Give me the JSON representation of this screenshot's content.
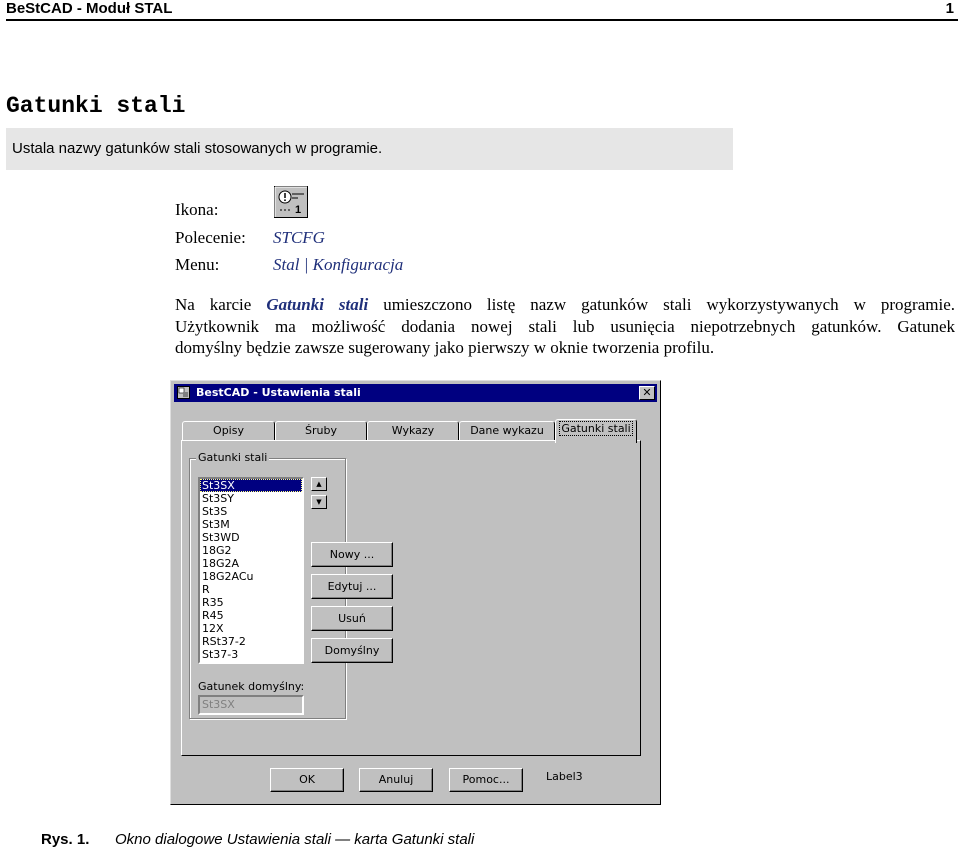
{
  "header": {
    "title": "BeStCAD - Moduł STAL",
    "page_number": "1"
  },
  "section": {
    "title": "Gatunki stali",
    "summary": "Ustala nazwy gatunków stali stosowanych w programie."
  },
  "meta": {
    "icon_label": "Ikona:",
    "command_label": "Polecenie:",
    "command_value": "STCFG",
    "menu_label": "Menu:",
    "menu_value": "Stal | Konfiguracja",
    "icon_name": "steel-config-toolbar-icon"
  },
  "paragraph": {
    "line1_before": "Na karcie ",
    "line1_emph": "Gatunki stali",
    "line1_after": " umieszczono listę nazw gatunków stali wykorzystywanych w programie.",
    "line2": "Użytkownik ma możliwość dodania nowej stali lub usunięcia niepotrzebnych gatunków. Gatunek",
    "line3": "domyślny będzie zawsze sugerowany jako pierwszy w oknie tworzenia profilu."
  },
  "dialog": {
    "title": "BestCAD - Ustawienia stali",
    "close_glyph": "✕",
    "tabs": [
      "Opisy",
      "Śruby",
      "Wykazy",
      "Dane wykazu",
      "Gatunki stali"
    ],
    "active_tab": "Gatunki stali",
    "group_label": "Gatunki stali",
    "steel_grades": [
      "St3SX",
      "St3SY",
      "St3S",
      "St3M",
      "St3WD",
      "18G2",
      "18G2A",
      "18G2ACu",
      "R",
      "R35",
      "R45",
      "12X",
      "RSt37-2",
      "St37-3"
    ],
    "selected_grade": "St3SX",
    "spin_up": "▲",
    "spin_down": "▼",
    "buttons": {
      "new": "Nowy ...",
      "edit": "Edytuj ...",
      "delete": "Usuń",
      "default": "Domyślny",
      "ok": "OK",
      "cancel": "Anuluj",
      "help": "Pomoc..."
    },
    "default_label": "Gatunek domyślny:",
    "default_value": "St3SX",
    "extra_label": "Label3"
  },
  "caption": {
    "number": "Rys. 1.",
    "text": "Okno dialogowe Ustawienia stali — karta Gatunki stali"
  }
}
